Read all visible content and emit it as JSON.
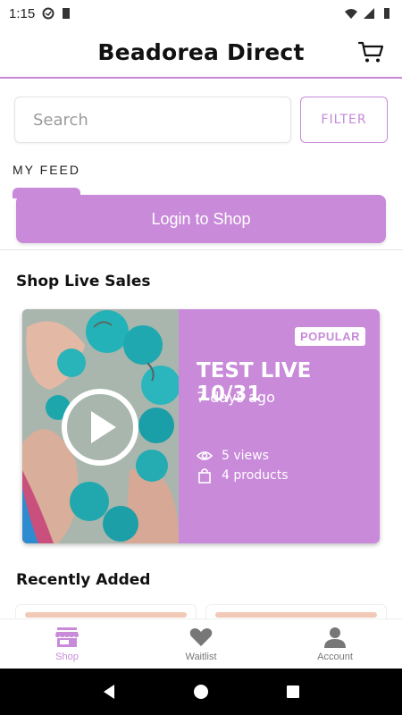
{
  "status_bar": {
    "time": "1:15"
  },
  "header": {
    "title": "Beadorea Direct"
  },
  "search": {
    "placeholder": "Search",
    "filter_label": "FILTER"
  },
  "feed": {
    "label": "MY FEED",
    "login_label": "Login to Shop"
  },
  "live_sales": {
    "title": "Shop Live Sales",
    "card": {
      "badge": "POPULAR",
      "name": "TEST LIVE 10/31",
      "time": "7 days ago",
      "views": "5 views",
      "products": "4 products"
    }
  },
  "recently_added": {
    "title": "Recently Added"
  },
  "bottom_nav": [
    {
      "label": "Shop",
      "icon": "storefront-icon",
      "active": true
    },
    {
      "label": "Waitlist",
      "icon": "heart-icon",
      "active": false
    },
    {
      "label": "Account",
      "icon": "person-icon",
      "active": false
    }
  ],
  "colors": {
    "accent": "#c88ad9",
    "text": "#111111",
    "nav_inactive": "#777777"
  }
}
